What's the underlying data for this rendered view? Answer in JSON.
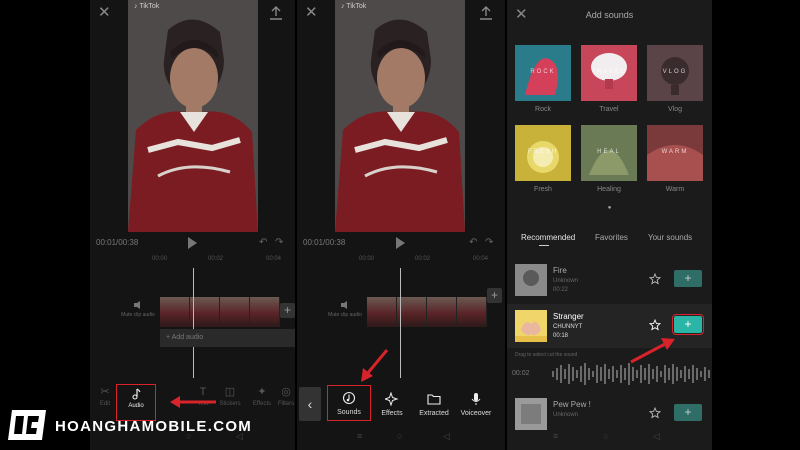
{
  "panel1": {
    "timecode": "00:01/00:38",
    "ticks": [
      "00:00",
      "00:02",
      "00:04"
    ],
    "mute_label": "Mute clip audio",
    "add_audio": "+ Add audio",
    "tools": [
      {
        "label": "Edit",
        "icon": "scissors-icon"
      },
      {
        "label": "Audio",
        "icon": "music-note-icon"
      },
      {
        "label": "Text",
        "icon": "text-icon"
      },
      {
        "label": "Stickers",
        "icon": "sticker-icon"
      },
      {
        "label": "Effects",
        "icon": "effects-icon"
      },
      {
        "label": "Filters",
        "icon": "filter-icon"
      }
    ],
    "highlight_tool": "Audio"
  },
  "panel2": {
    "timecode": "00:01/00:38",
    "ticks": [
      "00:00",
      "00:02",
      "00:04"
    ],
    "mute_label": "Mute clip audio",
    "tools": [
      {
        "label": "Sounds",
        "icon": "sounds-icon"
      },
      {
        "label": "Effects",
        "icon": "sparkle-icon"
      },
      {
        "label": "Extracted",
        "icon": "folder-icon"
      },
      {
        "label": "Voiceover",
        "icon": "microphone-icon"
      }
    ],
    "highlight_tool": "Sounds"
  },
  "panel3": {
    "title": "Add sounds",
    "categories": [
      {
        "label": "Rock",
        "art": "ROCK",
        "color": "#2a7c8a"
      },
      {
        "label": "Travel",
        "art": "TRAVEL",
        "color": "#c7465a"
      },
      {
        "label": "Vlog",
        "art": "VLOG",
        "color": "#5a4448"
      },
      {
        "label": "Fresh",
        "art": "FRESH",
        "color": "#c8b23a"
      },
      {
        "label": "Healing",
        "art": "HEAL",
        "color": "#6a7a55"
      },
      {
        "label": "Warm",
        "art": "WARM",
        "color": "#7a3a3c"
      }
    ],
    "tabs": [
      "Recommended",
      "Favorites",
      "Your sounds"
    ],
    "active_tab": "Recommended",
    "songs": [
      {
        "title": "Fire",
        "artist": "Unknown",
        "duration": "00:22"
      },
      {
        "title": "Stranger",
        "artist": "CHUNNYT",
        "duration": "00:18"
      },
      {
        "title": "Pew Pew !",
        "artist": "Unknown",
        "duration": ""
      }
    ],
    "drag_hint": "Drag to select cut the sound",
    "wave_time": "00:02"
  },
  "brand": {
    "name": "HOANGHAMOBILE.COM"
  },
  "colors": {
    "callout_red": "#d8232a",
    "add_teal": "#2bb5a6",
    "add_teal_dim": "#2e6e66"
  }
}
